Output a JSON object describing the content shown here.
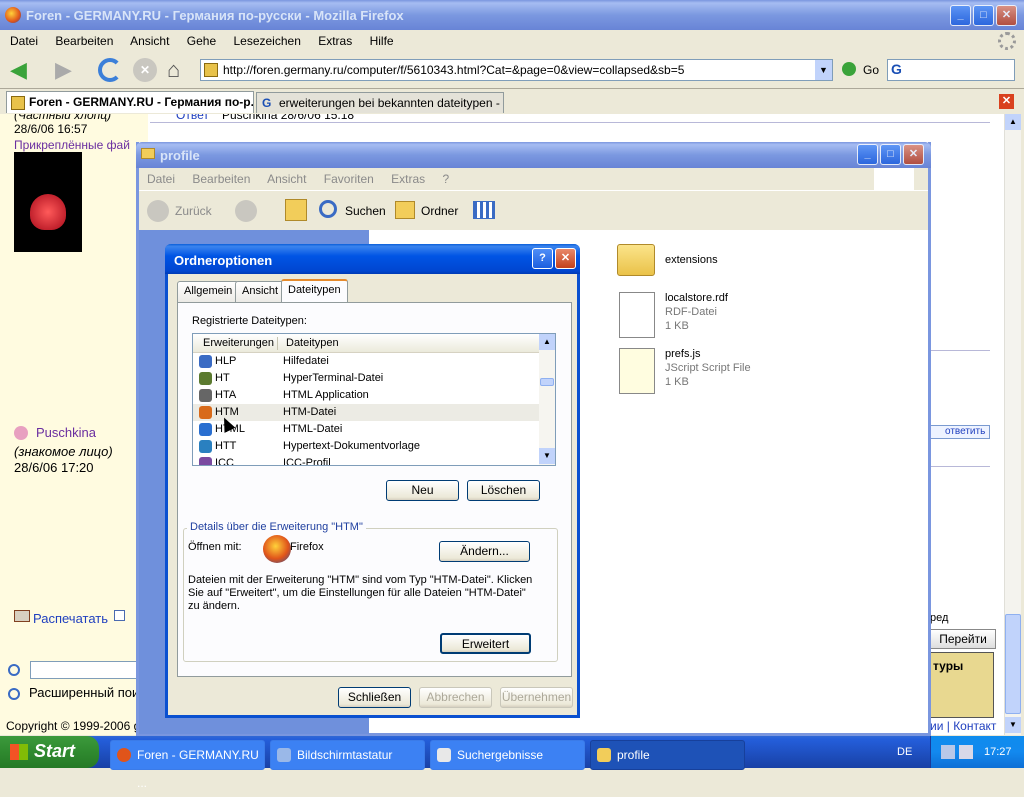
{
  "firefox": {
    "title": "Foren - GERMANY.RU - Германия по-русски - Mozilla Firefox",
    "menu": [
      "Datei",
      "Bearbeiten",
      "Ansicht",
      "Gehe",
      "Lesezeichen",
      "Extras",
      "Hilfe"
    ],
    "url": "http://foren.germany.ru/computer/f/5610343.html?Cat=&page=0&view=collapsed&sb=5",
    "go": "Go",
    "tabs": [
      "Foren - GERMANY.RU - Германия по-р...",
      "erweiterungen bei bekannten dateitypen - ..."
    ]
  },
  "forum": {
    "top_user": "(Частный хлопц)",
    "top_date": "28/6/06 16:57",
    "attachments": "Прикреплённые фай",
    "reply_top": "Ответ",
    "reply_top_text": "Puschkina 28/6/06 15:18",
    "user": "Puschkina",
    "status": "(знакомое лицо)",
    "date": "28/6/06 17:20",
    "reply": "ответить",
    "print": "Распечатать",
    "adv_search": "Расширенный пои",
    "copyright": "Copyright © 1999-2006 ge",
    "contact": "ии | Контакт",
    "goto": "Перейти",
    "ad_text": "туры",
    "red_text": "ред"
  },
  "explorer": {
    "title": "profile",
    "menu": [
      "Datei",
      "Bearbeiten",
      "Ansicht",
      "Favoriten",
      "Extras",
      "?"
    ],
    "back": "Zurück",
    "search": "Suchen",
    "folders": "Ordner",
    "files": [
      {
        "name": "extensions",
        "type": "",
        "size": "",
        "icon": "folder-icon"
      },
      {
        "name": "localstore.rdf",
        "type": "RDF-Datei",
        "size": "1 KB",
        "icon": "rdf-file-icon"
      },
      {
        "name": "prefs.js",
        "type": "JScript Script File",
        "size": "1 KB",
        "icon": "script-file-icon"
      }
    ]
  },
  "dialog": {
    "title": "Ordneroptionen",
    "tabs": [
      "Allgemein",
      "Ansicht",
      "Dateitypen"
    ],
    "registered_label": "Registrierte Dateitypen:",
    "col_ext": "Erweiterungen",
    "col_type": "Dateitypen",
    "rows": [
      {
        "ext": "HLP",
        "type": "Hilfedatei",
        "icon": "help-file-icon",
        "color": "#3a6bc4"
      },
      {
        "ext": "HT",
        "type": "HyperTerminal-Datei",
        "icon": "hyperterminal-icon",
        "color": "#5b7a2f"
      },
      {
        "ext": "HTA",
        "type": "HTML Application",
        "icon": "hta-icon",
        "color": "#666666"
      },
      {
        "ext": "HTM",
        "type": "HTM-Datei",
        "icon": "firefox-file-icon",
        "color": "#d86a1a"
      },
      {
        "ext": "HTML",
        "type": "HTML-Datei",
        "icon": "ie-file-icon",
        "color": "#2a6fd0"
      },
      {
        "ext": "HTT",
        "type": "Hypertext-Dokumentvorlage",
        "icon": "htt-icon",
        "color": "#2a80c0"
      },
      {
        "ext": "ICC",
        "type": "ICC-Profil",
        "icon": "icc-icon",
        "color": "#7a4aa0"
      }
    ],
    "new": "Neu",
    "delete": "Löschen",
    "details_legend": "Details über die Erweiterung \"HTM\"",
    "opens_with": "Öffnen mit:",
    "app": "Firefox",
    "change": "Ändern...",
    "description": "Dateien mit der Erweiterung \"HTM\" sind vom Typ \"HTM-Datei\". Klicken Sie auf \"Erweitert\", um die Einstellungen für alle Dateien \"HTM-Datei\" zu ändern.",
    "advanced": "Erweitert",
    "close": "Schließen",
    "cancel": "Abbrechen",
    "apply": "Übernehmen"
  },
  "taskbar": {
    "start": "Start",
    "items": [
      "Foren - GERMANY.RU ...",
      "Bildschirmtastatur",
      "Suchergebnisse",
      "profile"
    ],
    "lang": "DE",
    "time": "17:27"
  }
}
